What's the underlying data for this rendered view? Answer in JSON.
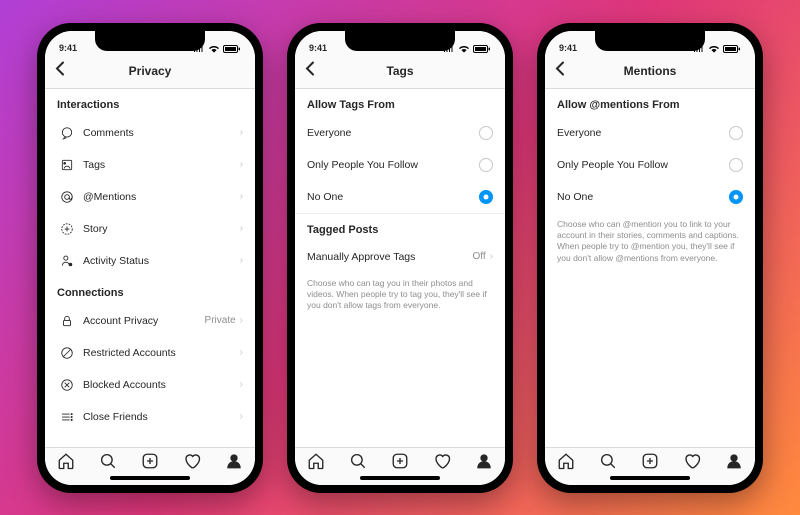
{
  "status": {
    "time": "9:41"
  },
  "tabs": {
    "home": "home",
    "search": "search",
    "add": "add",
    "heart": "heart",
    "profile": "profile"
  },
  "phones": [
    {
      "title": "Privacy",
      "sections": [
        {
          "header": "Interactions",
          "rows": [
            {
              "icon": "comment-icon",
              "label": "Comments",
              "chev": true
            },
            {
              "icon": "tag-icon",
              "label": "Tags",
              "chev": true
            },
            {
              "icon": "mention-icon",
              "label": "@Mentions",
              "chev": true
            },
            {
              "icon": "story-icon",
              "label": "Story",
              "chev": true
            },
            {
              "icon": "activity-icon",
              "label": "Activity Status",
              "chev": true
            }
          ]
        },
        {
          "header": "Connections",
          "rows": [
            {
              "icon": "lock-icon",
              "label": "Account Privacy",
              "value": "Private",
              "chev": true
            },
            {
              "icon": "restricted-icon",
              "label": "Restricted Accounts",
              "chev": true
            },
            {
              "icon": "blocked-icon",
              "label": "Blocked Accounts",
              "chev": true
            },
            {
              "icon": "close-friends-icon",
              "label": "Close Friends",
              "chev": true
            }
          ]
        }
      ]
    },
    {
      "title": "Tags",
      "sections": [
        {
          "header": "Allow Tags From",
          "rows": [
            {
              "label": "Everyone",
              "radio": true,
              "selected": false
            },
            {
              "label": "Only People You Follow",
              "radio": true,
              "selected": false
            },
            {
              "label": "No One",
              "radio": true,
              "selected": true
            }
          ]
        },
        {
          "header": "Tagged Posts",
          "rows": [
            {
              "label": "Manually Approve Tags",
              "value": "Off",
              "chev": true
            }
          ],
          "help": "Choose who can tag you in their photos and videos. When people try to tag you, they'll see if you don't allow tags from everyone."
        }
      ]
    },
    {
      "title": "Mentions",
      "sections": [
        {
          "header": "Allow @mentions From",
          "rows": [
            {
              "label": "Everyone",
              "radio": true,
              "selected": false
            },
            {
              "label": "Only People You Follow",
              "radio": true,
              "selected": false
            },
            {
              "label": "No One",
              "radio": true,
              "selected": true
            }
          ],
          "help": "Choose who can @mention you to link to your account in their stories, comments and captions. When people try to @mention you, they'll see if you don't allow @mentions from everyone."
        }
      ]
    }
  ]
}
